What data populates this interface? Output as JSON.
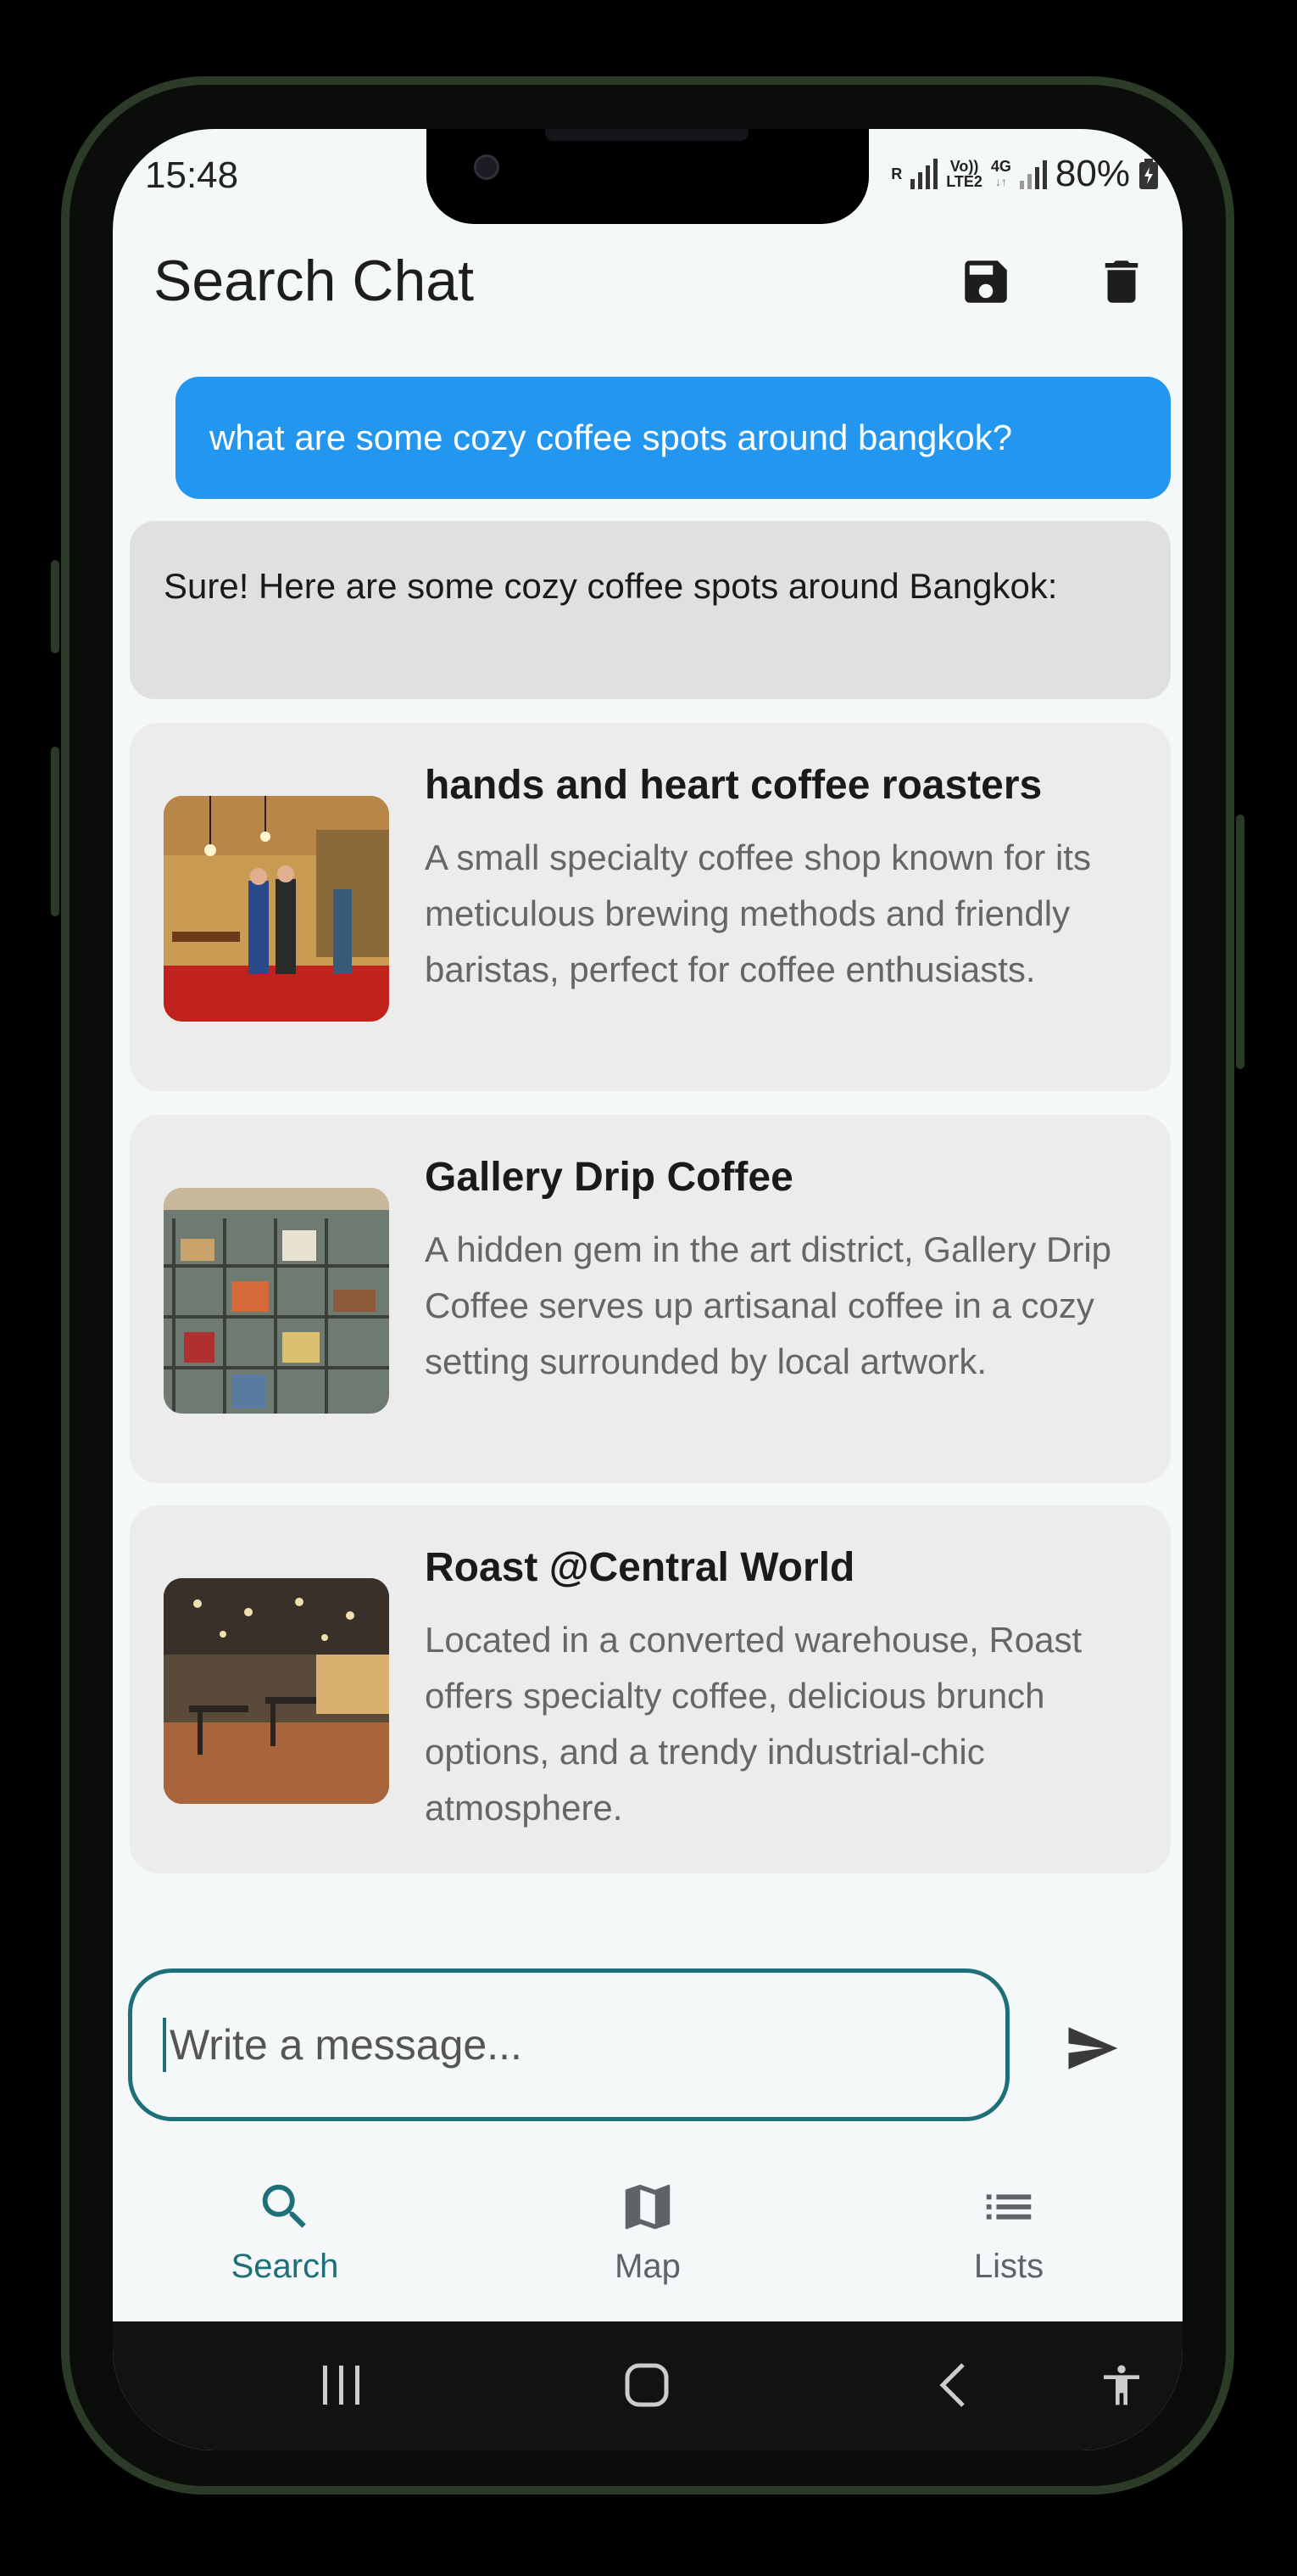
{
  "status": {
    "time": "15:48",
    "net_r": "R",
    "volte": "Vo))",
    "lte": "LTE2",
    "gen": "4G",
    "battery": "80%"
  },
  "appbar": {
    "title": "Search Chat",
    "save_icon": "save-icon",
    "delete_icon": "delete-icon"
  },
  "chat": {
    "user_message": "what are some cozy coffee spots around bangkok?",
    "bot_message": "Sure! Here are some cozy coffee spots around Bangkok:"
  },
  "results": [
    {
      "title": "hands and heart coffee roasters",
      "description": "A small specialty coffee shop known for its meticulous brewing methods and friendly baristas, perfect for coffee enthusiasts."
    },
    {
      "title": "Gallery Drip Coffee",
      "description": "A hidden gem in the art district, Gallery Drip Coffee serves up artisanal coffee in a cozy setting surrounded by local artwork."
    },
    {
      "title": "Roast @Central World",
      "description": "Located in a converted warehouse, Roast offers specialty coffee, delicious brunch options, and a trendy industrial-chic atmosphere."
    }
  ],
  "composer": {
    "placeholder": "Write a message...",
    "send_icon": "send-icon"
  },
  "bottom_nav": [
    {
      "label": "Search",
      "icon": "search-icon",
      "active": true,
      "color": "#1e6f78"
    },
    {
      "label": "Map",
      "icon": "map-icon",
      "active": false,
      "color": "#5f6368"
    },
    {
      "label": "Lists",
      "icon": "list-icon",
      "active": false,
      "color": "#5f6368"
    }
  ],
  "system_nav": {
    "recents_icon": "recents-icon",
    "home_icon": "home-icon",
    "back_icon": "back-icon",
    "accessibility_icon": "accessibility-icon"
  },
  "colors": {
    "accent": "#1e6f78",
    "user_bubble": "#2396f0",
    "bot_bubble": "#e0e0e0",
    "card": "#ececed"
  }
}
